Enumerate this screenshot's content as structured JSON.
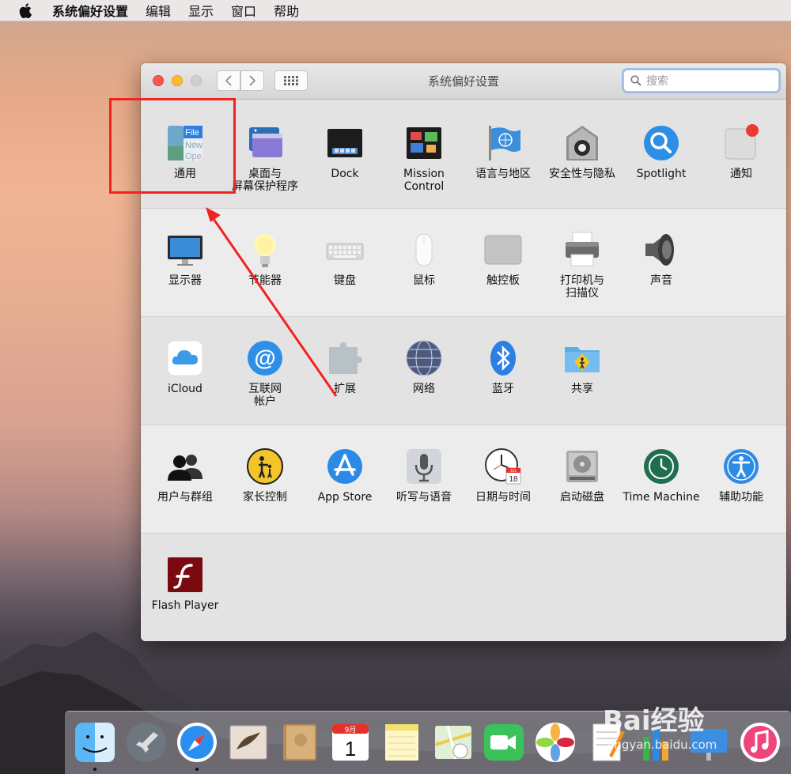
{
  "menubar": {
    "app_name": "系统偏好设置",
    "items": [
      "编辑",
      "显示",
      "窗口",
      "帮助"
    ]
  },
  "window": {
    "title": "系统偏好设置",
    "search_placeholder": "搜索"
  },
  "sections": [
    {
      "panes": [
        {
          "label": "通用",
          "icon": "general-icon"
        },
        {
          "label": "桌面与\n屏幕保护程序",
          "icon": "desktop-screensaver-icon"
        },
        {
          "label": "Dock",
          "icon": "dock-icon"
        },
        {
          "label": "Mission\nControl",
          "icon": "mission-control-icon"
        },
        {
          "label": "语言与地区",
          "icon": "language-region-icon"
        },
        {
          "label": "安全性与隐私",
          "icon": "security-privacy-icon"
        },
        {
          "label": "Spotlight",
          "icon": "spotlight-icon"
        },
        {
          "label": "通知",
          "icon": "notifications-icon"
        }
      ]
    },
    {
      "panes": [
        {
          "label": "显示器",
          "icon": "displays-icon"
        },
        {
          "label": "节能器",
          "icon": "energy-saver-icon"
        },
        {
          "label": "键盘",
          "icon": "keyboard-icon"
        },
        {
          "label": "鼠标",
          "icon": "mouse-icon"
        },
        {
          "label": "触控板",
          "icon": "trackpad-icon"
        },
        {
          "label": "打印机与\n扫描仪",
          "icon": "printers-scanners-icon"
        },
        {
          "label": "声音",
          "icon": "sound-icon"
        }
      ]
    },
    {
      "panes": [
        {
          "label": "iCloud",
          "icon": "icloud-icon"
        },
        {
          "label": "互联网\n帐户",
          "icon": "internet-accounts-icon"
        },
        {
          "label": "扩展",
          "icon": "extensions-icon"
        },
        {
          "label": "网络",
          "icon": "network-icon"
        },
        {
          "label": "蓝牙",
          "icon": "bluetooth-icon"
        },
        {
          "label": "共享",
          "icon": "sharing-icon"
        }
      ]
    },
    {
      "panes": [
        {
          "label": "用户与群组",
          "icon": "users-groups-icon"
        },
        {
          "label": "家长控制",
          "icon": "parental-controls-icon"
        },
        {
          "label": "App Store",
          "icon": "app-store-icon"
        },
        {
          "label": "听写与语音",
          "icon": "dictation-speech-icon"
        },
        {
          "label": "日期与时间",
          "icon": "date-time-icon"
        },
        {
          "label": "启动磁盘",
          "icon": "startup-disk-icon"
        },
        {
          "label": "Time Machine",
          "icon": "time-machine-icon"
        },
        {
          "label": "辅助功能",
          "icon": "accessibility-icon"
        }
      ]
    },
    {
      "panes": [
        {
          "label": "Flash Player",
          "icon": "flash-player-icon"
        }
      ]
    }
  ],
  "icon_text": {
    "general": [
      "File",
      "New",
      "Ope"
    ],
    "calendar_month": "JUL",
    "calendar_day": "18"
  },
  "dock": {
    "items": [
      "finder-icon",
      "launchpad-icon",
      "safari-icon",
      "mail-icon",
      "contacts-icon",
      "calendar-icon",
      "notes-icon",
      "maps-icon",
      "facetime-icon",
      "photos-icon",
      "pages-icon",
      "numbers-icon",
      "keynote-icon",
      "itunes-icon"
    ],
    "calendar_month": "9月",
    "calendar_day": "1"
  },
  "watermark": {
    "logo": "Bai经验",
    "url": "jingyan.baidu.com"
  },
  "colors": {
    "highlight": "#f2221f",
    "arrow": "#f2221f"
  }
}
